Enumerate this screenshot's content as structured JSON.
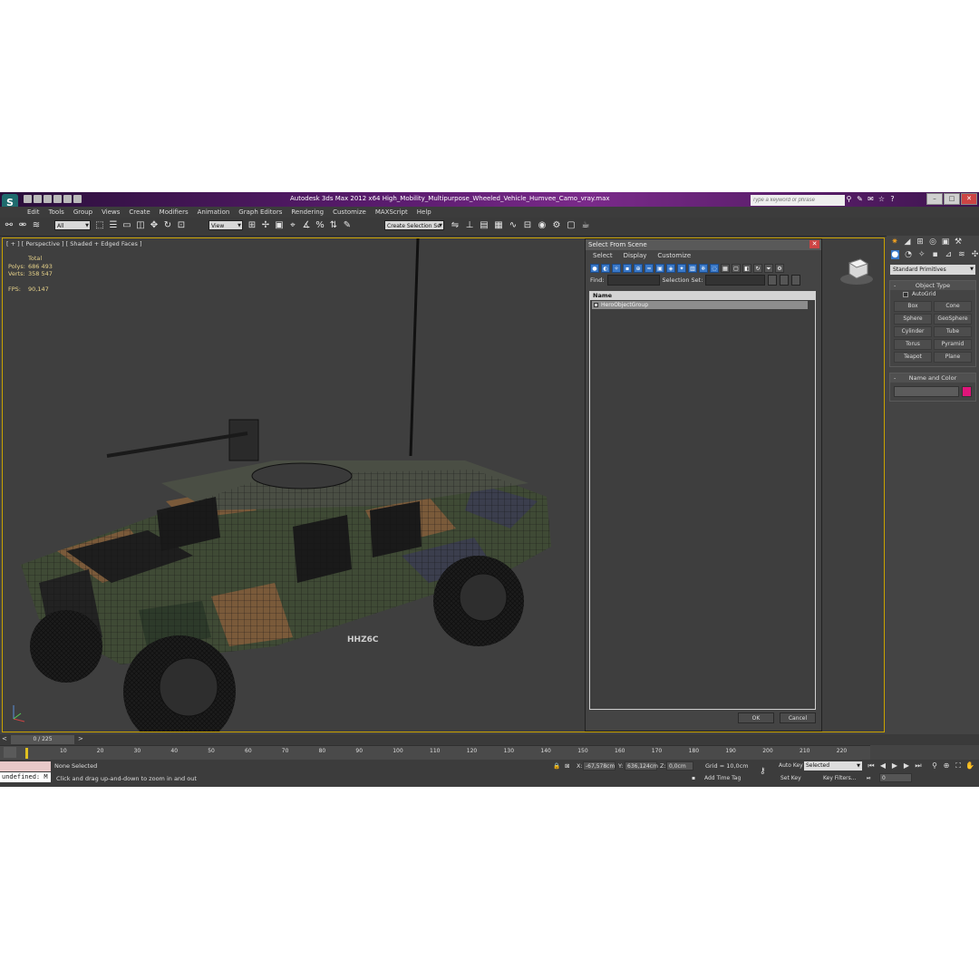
{
  "app": {
    "logo_letter": "S",
    "title": "Autodesk 3ds Max  2012 x64     High_Mobility_Multipurpose_Wheeled_Vehicle_Humvee_Camo_vray.max",
    "search_placeholder": "Type a keyword or phrase"
  },
  "menu": [
    "Edit",
    "Tools",
    "Group",
    "Views",
    "Create",
    "Modifiers",
    "Animation",
    "Graph Editors",
    "Rendering",
    "Customize",
    "MAXScript",
    "Help"
  ],
  "toolbar": {
    "filter_value": "All",
    "ref_coord_value": "View",
    "selection_set_value": "Create Selection Se"
  },
  "viewport": {
    "label": "[ + ] [ Perspective ] [ Shaded + Edged Faces ]",
    "stats_header": "Total",
    "polys_label": "Polys:",
    "polys_value": "686 493",
    "verts_label": "Verts:",
    "verts_value": "358 547",
    "fps_label": "FPS:",
    "fps_value": "90,147",
    "vehicle_marking": "HHZ6C"
  },
  "dialog": {
    "title": "Select From Scene",
    "menu": [
      "Select",
      "Display",
      "Customize"
    ],
    "find_label": "Find:",
    "selection_set_label": "Selection Set:",
    "column_name": "Name",
    "items": [
      "HeroObjectGroup"
    ],
    "ok_label": "OK",
    "cancel_label": "Cancel"
  },
  "command_panel": {
    "category_value": "Standard Primitives",
    "object_type_title": "Object Type",
    "autogrid_label": "AutoGrid",
    "primitives": [
      "Box",
      "Cone",
      "Sphere",
      "GeoSphere",
      "Cylinder",
      "Tube",
      "Torus",
      "Pyramid",
      "Teapot",
      "Plane"
    ],
    "name_color_title": "Name and Color",
    "object_color": "#e0157a"
  },
  "timeline": {
    "frame_readout": "0 / 225",
    "ticks": [
      "10",
      "20",
      "30",
      "40",
      "50",
      "60",
      "70",
      "80",
      "90",
      "100",
      "110",
      "120",
      "130",
      "140",
      "150",
      "160",
      "170",
      "180",
      "190",
      "200",
      "210",
      "220"
    ]
  },
  "status": {
    "maxscript_value": "undefined: M",
    "selection_text": "None Selected",
    "prompt_text": "Click and drag up-and-down to zoom in and out",
    "x_label": "X:",
    "x_value": "-67,578cm",
    "y_label": "Y:",
    "y_value": "636,124cm",
    "z_label": "Z:",
    "z_value": "0,0cm",
    "grid_text": "Grid = 10,0cm",
    "add_time_tag": "Add Time Tag",
    "auto_key": "Auto Key",
    "set_key": "Set Key",
    "key_mode_value": "Selected",
    "key_filters": "Key Filters...",
    "frame_value": "0"
  }
}
